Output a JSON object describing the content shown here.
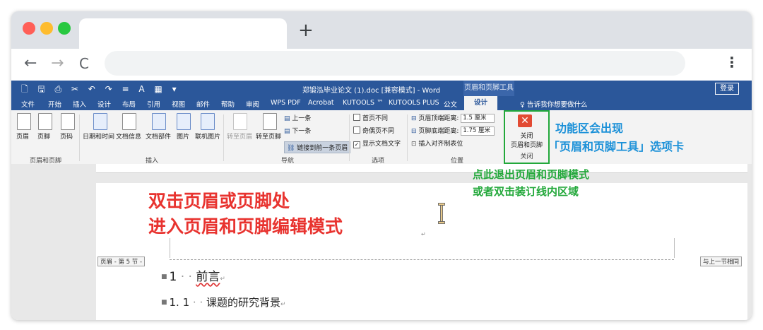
{
  "browser": {
    "new_tab_glyph": "+",
    "back_glyph": "←",
    "forward_glyph": "→",
    "reload_glyph": "C",
    "menu_glyph": "⋮"
  },
  "word": {
    "title": "郑锻泓毕业论文 (1).doc [兼容模式] - Word",
    "context_group": "页眉和页脚工具",
    "login_label": "登录",
    "tabs": [
      "文件",
      "开始",
      "插入",
      "设计",
      "布局",
      "引用",
      "视图",
      "邮件",
      "帮助",
      "审阅",
      "WPS PDF",
      "Acrobat",
      "KUTOOLS ™",
      "KUTOOLS PLUS",
      "公文"
    ],
    "active_tab": "设计",
    "tell_me": "告诉我你想要做什么",
    "ribbon": {
      "header": "页眉",
      "footer": "页脚",
      "page_number": "页码",
      "group_header_footer": "页眉和页脚",
      "date_time": "日期和时间",
      "doc_info": "文档信息",
      "doc_parts": "文档部件",
      "picture": "图片",
      "online_picture": "联机图片",
      "group_insert": "插入",
      "goto_header": "转至页眉",
      "goto_footer": "转至页脚",
      "previous": "上一条",
      "next": "下一条",
      "link_previous": "链接到前一条页眉",
      "group_navigation": "导航",
      "different_first": "首页不同",
      "different_odd_even": "奇偶页不同",
      "show_doc_text": "显示文档文字",
      "group_options": "选项",
      "header_from_top": "页眉顶端距离:",
      "header_from_top_value": "1.5 厘米",
      "footer_from_bottom": "页脚底端距离:",
      "footer_from_bottom_value": "1.75 厘米",
      "insert_align_tab": "插入对齐制表位",
      "group_position": "位置",
      "close_line1": "关闭",
      "close_line2": "页眉和页脚",
      "group_close": "关闭"
    },
    "document": {
      "header_tag": "页眉 - 第 5 节 -",
      "same_as_previous": "与上一节相同",
      "heading1_number": "1",
      "heading1_text": "前言",
      "heading2_number": "1. 1",
      "heading2_text": "课题的研究背景"
    }
  },
  "annotations": {
    "red_line1": "双击页眉或页脚处",
    "red_line2": "进入页眉和页脚编辑模式",
    "blue_line1": "功能区会出现",
    "blue_line2": "「页眉和页脚工具」选项卡",
    "green_line1": "点此退出页眉和页脚模式",
    "green_line2": "或者双击装订线内区域"
  },
  "colors": {
    "word_blue": "#2b579a",
    "highlight_green": "#22a83a",
    "annotation_red": "#e8332f",
    "annotation_blue": "#1a90d8"
  }
}
